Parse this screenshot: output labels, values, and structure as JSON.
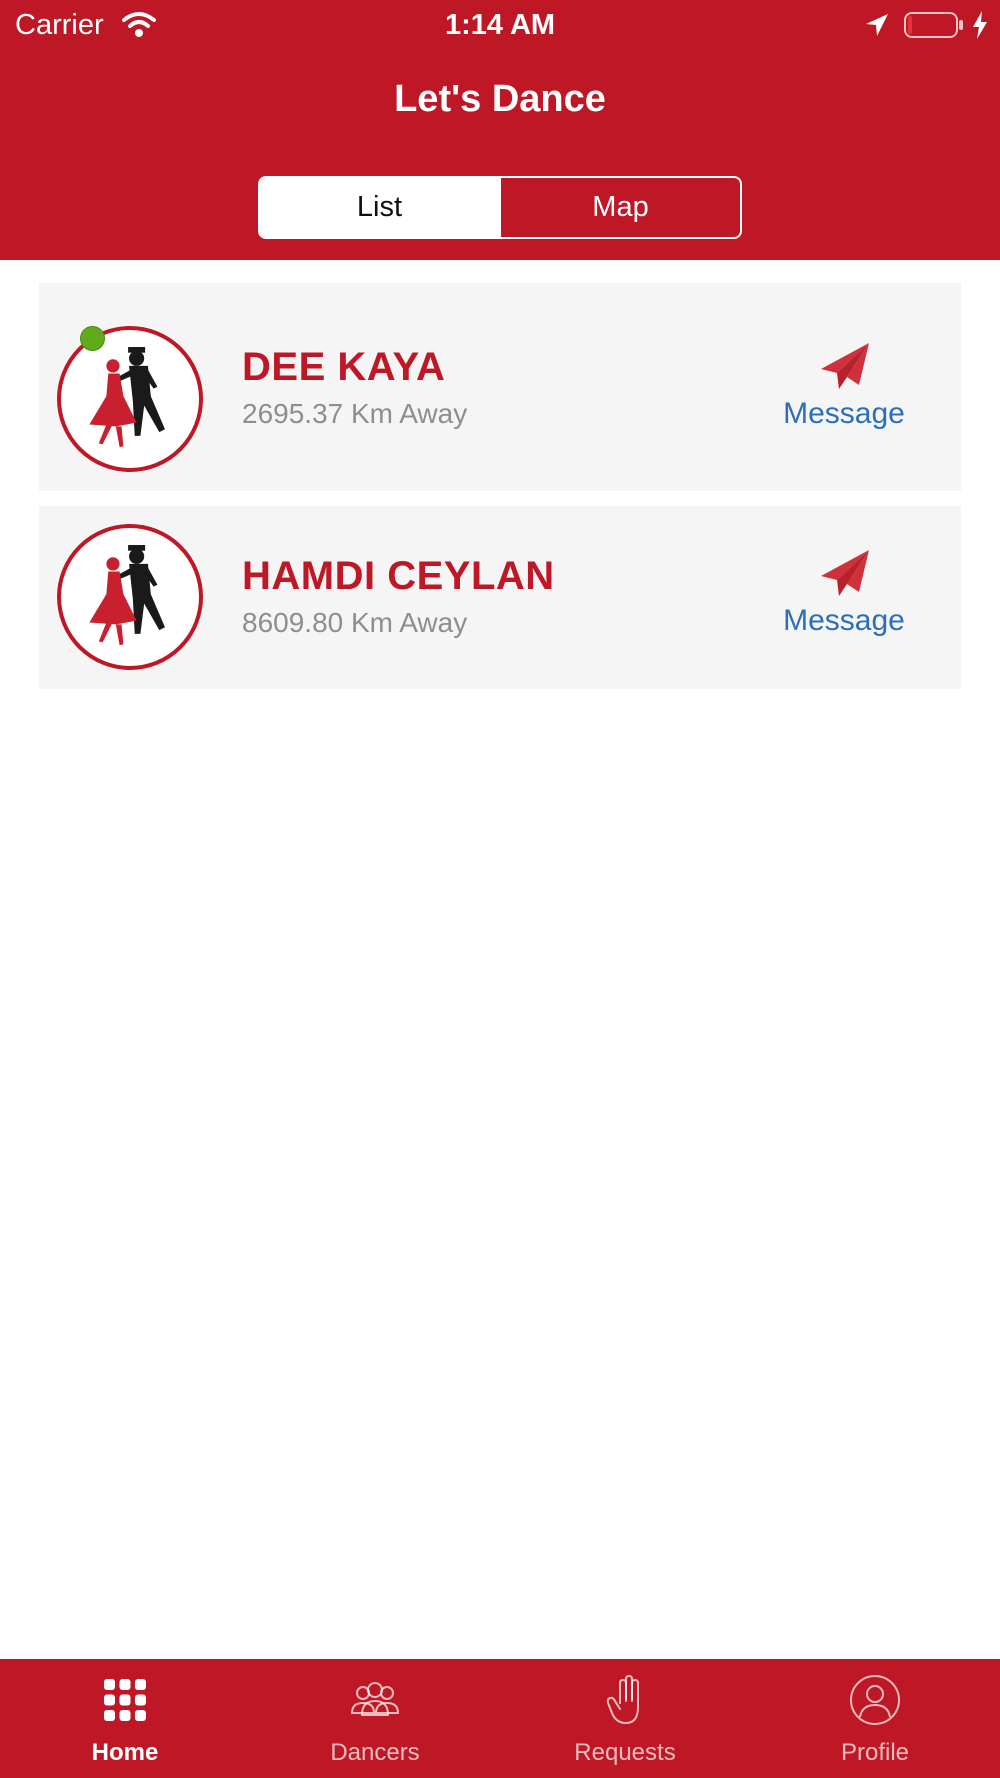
{
  "status_bar": {
    "carrier": "Carrier",
    "time": "1:14 AM"
  },
  "header": {
    "title": "Let's Dance"
  },
  "segment": {
    "list_label": "List",
    "map_label": "Map",
    "selected": "List"
  },
  "dancers": [
    {
      "name": "DEE KAYA",
      "distance": "2695.37 Km Away",
      "online": true,
      "action_label": "Message"
    },
    {
      "name": "HAMDI CEYLAN",
      "distance": "8609.80 Km Away",
      "online": false,
      "action_label": "Message"
    }
  ],
  "tabbar": {
    "items": [
      {
        "label": "Home",
        "icon": "grid-icon",
        "active": true
      },
      {
        "label": "Dancers",
        "icon": "users-icon",
        "active": false
      },
      {
        "label": "Requests",
        "icon": "hand-icon",
        "active": false
      },
      {
        "label": "Profile",
        "icon": "profile-icon",
        "active": false
      }
    ]
  },
  "colors": {
    "brand": "#be1826",
    "online": "#5fab1b",
    "link": "#2a6fb8",
    "secondary_text": "#8e8e8e"
  }
}
